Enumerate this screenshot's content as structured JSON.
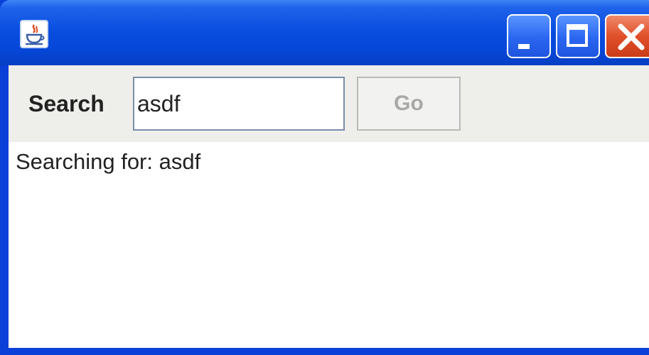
{
  "window": {
    "title": "",
    "colors": {
      "titlebar": "#0a4fe0",
      "frame": "#0a3fd8",
      "close_button": "#e0502a",
      "toolbar_bg": "#eeeeea"
    },
    "controls": {
      "minimize_icon": "minimize-icon",
      "maximize_icon": "maximize-icon",
      "close_icon": "close-icon"
    },
    "app_icon": "java-coffee-cup-icon"
  },
  "toolbar": {
    "search_label": "Search",
    "search_value": "asdf",
    "go_label": "Go",
    "go_enabled": false
  },
  "content": {
    "status": "Searching for: asdf"
  }
}
